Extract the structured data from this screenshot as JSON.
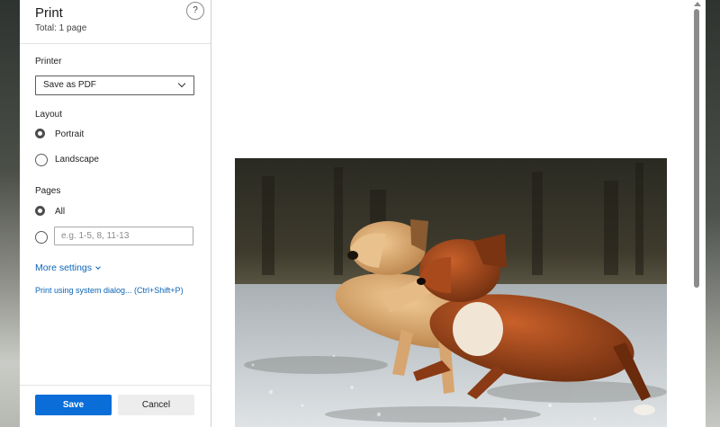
{
  "dialog": {
    "title": "Print",
    "subtitle": "Total: 1 page",
    "help_icon": "?"
  },
  "printer": {
    "label": "Printer",
    "selected": "Save as PDF"
  },
  "layout": {
    "label": "Layout",
    "options": [
      {
        "label": "Portrait",
        "checked": true
      },
      {
        "label": "Landscape",
        "checked": false
      }
    ]
  },
  "pages": {
    "label": "Pages",
    "all_label": "All",
    "custom_placeholder": "e.g. 1-5, 8, 11-13",
    "custom_value": ""
  },
  "links": {
    "more_settings": "More settings",
    "system_dialog": "Print using system dialog... (Ctrl+Shift+P)"
  },
  "buttons": {
    "save": "Save",
    "cancel": "Cancel"
  },
  "colors": {
    "accent": "#0a6dd8",
    "link": "#0a65b8"
  },
  "icons": {
    "help": "question-circle-icon",
    "dropdown": "chevron-down-icon",
    "more": "chevron-down-icon",
    "scroll": "scroll-up-arrow-icon"
  }
}
